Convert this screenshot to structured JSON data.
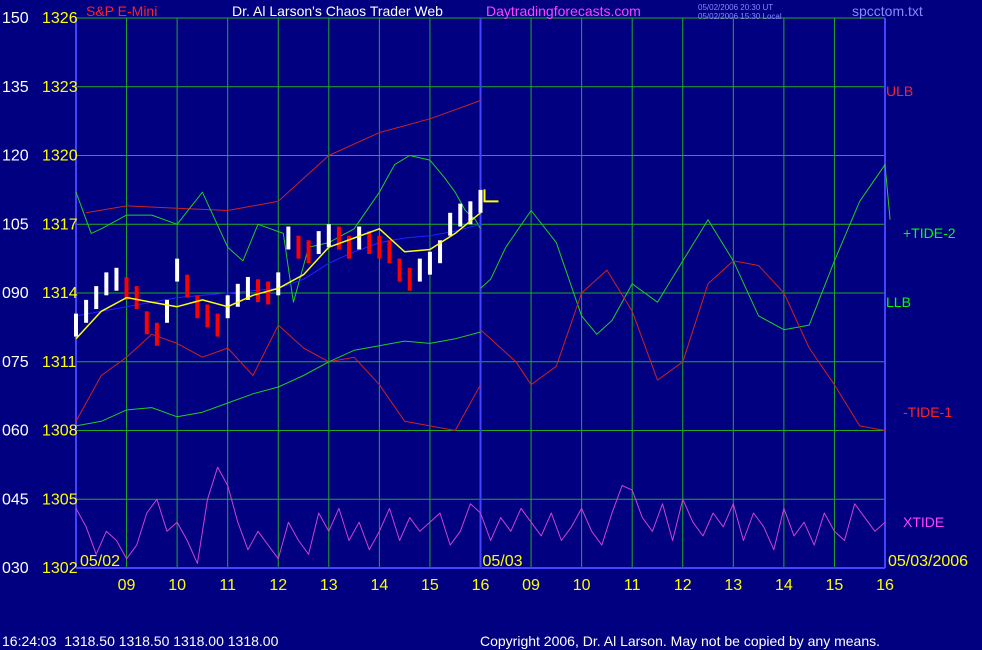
{
  "header": {
    "symbol_title": "S&P E-Mini",
    "site_title": "Dr. Al Larson's Chaos Trader Web",
    "site_url": "Daytradingforecasts.com",
    "timestamp_ut": "05/02/2006 20:30 UT",
    "timestamp_local": "05/02/2006 15:30 Local",
    "filename": "spcctom.txt"
  },
  "footer": {
    "quote": "16:24:03  1318.50 1318.50 1318.00 1318.00",
    "copyright": "Copyright 2006, Dr. Al Larson. May not be copied by any means."
  },
  "colors": {
    "background": "#000080",
    "grid": "#22aa22",
    "axis": "#4444ff",
    "ulb": "#cc2222",
    "tide2": "#22cc22",
    "tide1": "#cc2222",
    "xtide": "#cc44cc",
    "price_up": "#ffffff",
    "price_down": "#ff0000",
    "average": "#ffff00",
    "trend": "#2222ff",
    "yellow_label": "#ffff00",
    "green_label": "#00ff00",
    "red_label": "#ff2222",
    "magenta_label": "#ff44ff",
    "white_label": "#ffffff"
  },
  "chart_data": {
    "type": "line",
    "title": "S&P E-Mini",
    "y_left_osc_ticks": [
      "150",
      "135",
      "120",
      "105",
      "090",
      "075",
      "060",
      "045",
      "030"
    ],
    "y_left_price_ticks": [
      "1326",
      "1323",
      "1320",
      "1317",
      "1314",
      "1311",
      "1308",
      "1305",
      "1302"
    ],
    "price_range": [
      1302,
      1326
    ],
    "oscillator_range": [
      30,
      150
    ],
    "x_day_labels": [
      "05/02",
      "05/03",
      "05/03/2006"
    ],
    "x_hour_labels": [
      "09",
      "10",
      "11",
      "12",
      "13",
      "14",
      "15",
      "16",
      "09",
      "10",
      "11",
      "12",
      "13",
      "14",
      "15",
      "16"
    ],
    "day_divider_hour_index": 8,
    "series_labels": {
      "ulb": "ULB",
      "tide2": "+TIDE-2",
      "llb": "LLB",
      "tide1": "-TIDE-1",
      "xtide": "XTIDE"
    },
    "current_price": 1318.0,
    "series": [
      {
        "name": "ULB",
        "unit": "price",
        "x": [
          8.2,
          9,
          10,
          11,
          12,
          12.5,
          13,
          14,
          15,
          15.5,
          16
        ],
        "y": [
          1317.5,
          1317.8,
          1317.7,
          1317.6,
          1318.0,
          1319.0,
          1320.0,
          1321.0,
          1321.6,
          1322.0,
          1322.4
        ]
      },
      {
        "name": "+TIDE-2 (session 1)",
        "unit": "oscillator",
        "x": [
          8.0,
          8.3,
          8.5,
          9,
          9.5,
          10,
          10.5,
          11,
          11.3,
          11.6,
          12.1,
          12.3,
          12.6,
          13,
          13.5,
          14,
          14.3,
          14.6,
          15,
          15.3,
          15.5,
          15.7,
          15.9,
          16.0
        ],
        "y": [
          112,
          103,
          104,
          107,
          107,
          105,
          112,
          100,
          97,
          105,
          103,
          88,
          100,
          101,
          104,
          112,
          118,
          120,
          119,
          115,
          112,
          108,
          106,
          104
        ]
      },
      {
        "name": "+TIDE-2 (session 2)",
        "unit": "oscillator",
        "x": [
          16.0,
          16.2,
          16.5,
          17,
          17.5,
          18,
          18.3,
          18.6,
          19,
          19.5,
          20,
          20.5,
          21,
          21.5,
          22,
          22.5,
          23,
          23.5,
          24.0,
          24.1
        ],
        "y": [
          91,
          93,
          100,
          108,
          101,
          85,
          81,
          84,
          92,
          88,
          97,
          106,
          97,
          85,
          82,
          83,
          97,
          110,
          118,
          106
        ]
      },
      {
        "name": "-TIDE-1 (session 1)",
        "unit": "oscillator",
        "x": [
          8.0,
          8.5,
          9,
          9.5,
          10,
          10.5,
          11,
          11.5,
          12,
          12.5,
          13,
          13.5,
          14,
          14.5,
          15,
          15.5,
          16.0
        ],
        "y": [
          62,
          72,
          76,
          81,
          79,
          76,
          78,
          72,
          83,
          78,
          75,
          76,
          70,
          62,
          61,
          60,
          70
        ]
      },
      {
        "name": "-TIDE-1 (session 2)",
        "unit": "oscillator",
        "x": [
          16.0,
          16.3,
          16.7,
          17,
          17.5,
          18,
          18.5,
          19,
          19.5,
          20,
          20.5,
          21,
          21.5,
          22,
          22.5,
          23,
          23.5,
          24.0
        ],
        "y": [
          82,
          79,
          75,
          70,
          74,
          90,
          95,
          86,
          71,
          75,
          92,
          97,
          96,
          90,
          78,
          70,
          61,
          60
        ]
      },
      {
        "name": "LLB",
        "unit": "price",
        "x": [
          8.0,
          8.5,
          9,
          9.5,
          10,
          10.5,
          11,
          11.5,
          12,
          12.5,
          13,
          13.5,
          14,
          14.5,
          15,
          15.5,
          16.0
        ],
        "y": [
          1308.2,
          1308.4,
          1308.9,
          1309.0,
          1308.6,
          1308.8,
          1309.2,
          1309.6,
          1309.9,
          1310.4,
          1311.0,
          1311.5,
          1311.7,
          1311.9,
          1311.8,
          1312.0,
          1312.3
        ]
      },
      {
        "name": "XTIDE",
        "unit": "oscillator",
        "x": [
          8.0,
          8.2,
          8.4,
          8.6,
          8.8,
          9.0,
          9.2,
          9.4,
          9.6,
          9.8,
          10.0,
          10.2,
          10.4,
          10.6,
          10.8,
          11.0,
          11.2,
          11.4,
          11.6,
          11.8,
          12.0,
          12.2,
          12.4,
          12.6,
          12.8,
          13.0,
          13.2,
          13.4,
          13.6,
          13.8,
          14.0,
          14.2,
          14.4,
          14.6,
          14.8,
          15.0,
          15.2,
          15.4,
          15.6,
          15.8,
          16.0,
          16.2,
          16.4,
          16.6,
          16.8,
          17.0,
          17.2,
          17.4,
          17.6,
          17.8,
          18.0,
          18.2,
          18.4,
          18.6,
          18.8,
          19.0,
          19.2,
          19.4,
          19.6,
          19.8,
          20.0,
          20.2,
          20.4,
          20.6,
          20.8,
          21.0,
          21.2,
          21.4,
          21.6,
          21.8,
          22.0,
          22.2,
          22.4,
          22.6,
          22.8,
          23.0,
          23.2,
          23.4,
          23.6,
          23.8,
          24.0
        ],
        "y": [
          43,
          39,
          33,
          38,
          36,
          32,
          35,
          42,
          45,
          38,
          40,
          36,
          31,
          45,
          52,
          48,
          40,
          34,
          38,
          35,
          32,
          40,
          36,
          33,
          42,
          38,
          43,
          36,
          40,
          34,
          38,
          43,
          36,
          41,
          38,
          40,
          42,
          35,
          38,
          44,
          42,
          36,
          41,
          38,
          43,
          40,
          37,
          42,
          36,
          39,
          43,
          38,
          35,
          42,
          48,
          47,
          41,
          38,
          44,
          36,
          45,
          40,
          37,
          42,
          39,
          44,
          36,
          42,
          39,
          34,
          43,
          37,
          40,
          35,
          42,
          38,
          36,
          44,
          41,
          38,
          40
        ]
      },
      {
        "name": "Price average",
        "unit": "price",
        "x": [
          8.0,
          8.5,
          9,
          9.5,
          10,
          10.5,
          11,
          11.5,
          12,
          12.5,
          13,
          13.5,
          14,
          14.5,
          15,
          15.5,
          16.0
        ],
        "y": [
          1312.0,
          1313.2,
          1313.8,
          1313.6,
          1313.4,
          1313.7,
          1313.4,
          1313.9,
          1314.2,
          1314.8,
          1316.0,
          1316.4,
          1316.8,
          1315.8,
          1315.9,
          1316.6,
          1317.5
        ]
      },
      {
        "name": "Trend",
        "unit": "price",
        "x": [
          8.0,
          9.0,
          10.0,
          11.0,
          12.0,
          12.5,
          13.0,
          13.5,
          14.0,
          14.5,
          15.0,
          15.5,
          16.0
        ],
        "y": [
          1313.0,
          1313.4,
          1313.8,
          1314.0,
          1314.2,
          1314.6,
          1315.3,
          1315.8,
          1316.2,
          1316.4,
          1316.5,
          1316.7,
          1317.0
        ]
      },
      {
        "name": "Price",
        "unit": "price",
        "x": [
          8.0,
          8.2,
          8.4,
          8.6,
          8.8,
          9.0,
          9.2,
          9.4,
          9.6,
          9.8,
          10.0,
          10.2,
          10.4,
          10.6,
          10.8,
          11.0,
          11.2,
          11.4,
          11.6,
          11.8,
          12.0,
          12.2,
          12.4,
          12.6,
          12.8,
          13.0,
          13.2,
          13.4,
          13.6,
          13.8,
          14.0,
          14.2,
          14.4,
          14.6,
          14.8,
          15.0,
          15.2,
          15.4,
          15.6,
          15.8,
          16.0
        ],
        "y": [
          1312.6,
          1313.2,
          1313.8,
          1314.4,
          1314.6,
          1314.2,
          1313.8,
          1312.7,
          1312.2,
          1313.2,
          1315.0,
          1314.3,
          1313.4,
          1313.0,
          1312.6,
          1313.4,
          1313.9,
          1314.2,
          1314.1,
          1314.0,
          1314.4,
          1316.4,
          1316.0,
          1315.8,
          1316.2,
          1316.5,
          1316.4,
          1316.0,
          1316.4,
          1316.2,
          1316.0,
          1315.8,
          1315.0,
          1314.6,
          1315.0,
          1315.3,
          1315.8,
          1317.0,
          1317.4,
          1317.5,
          1318.0
        ]
      }
    ]
  }
}
